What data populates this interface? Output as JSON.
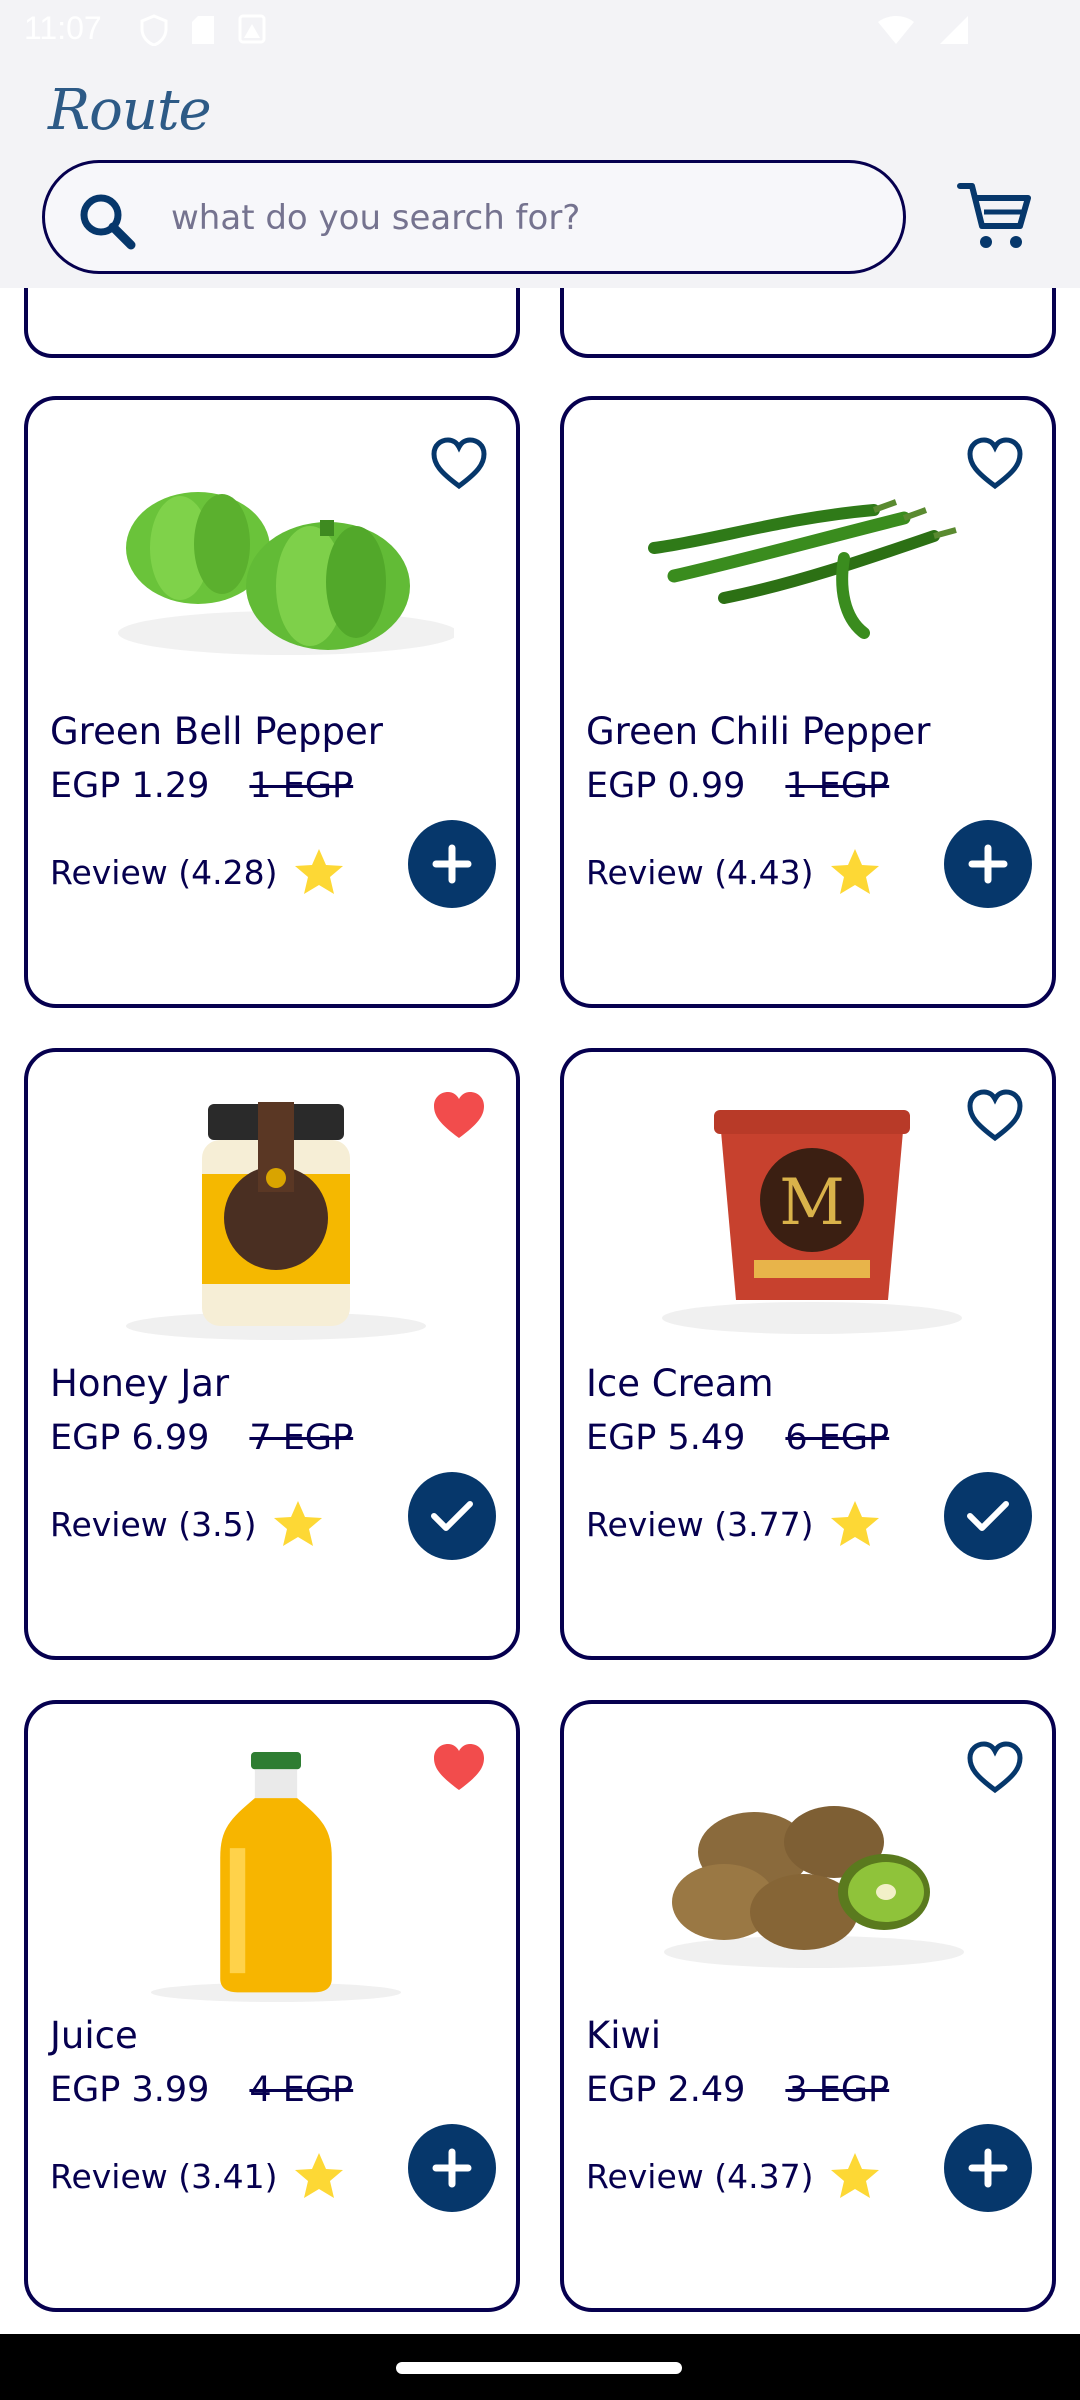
{
  "status_bar": {
    "time": "11:07"
  },
  "header": {
    "logo_text": "Route",
    "search": {
      "placeholder": "what do you search for?",
      "value": ""
    }
  },
  "theme": {
    "primary": "#06004F",
    "button": "#06376b",
    "favorite_active": "#f24c4c",
    "star": "#FDD835"
  },
  "products": [
    {
      "name": "Green Bell Pepper",
      "price": "EGP 1.29",
      "old_price": "1 EGP",
      "review": "Review (4.28)",
      "favorite": false,
      "in_cart": false,
      "image": "green-bell-pepper"
    },
    {
      "name": "Green Chili Pepper",
      "price": "EGP 0.99",
      "old_price": "1 EGP",
      "review": "Review (4.43)",
      "favorite": false,
      "in_cart": false,
      "image": "green-chili-pepper"
    },
    {
      "name": "Honey Jar",
      "price": "EGP 6.99",
      "old_price": "7 EGP",
      "review": "Review (3.5)",
      "favorite": true,
      "in_cart": true,
      "image": "honey-jar"
    },
    {
      "name": "Ice Cream",
      "price": "EGP 5.49",
      "old_price": "6 EGP",
      "review": "Review (3.77)",
      "favorite": false,
      "in_cart": true,
      "image": "ice-cream"
    },
    {
      "name": "Juice",
      "price": "EGP 3.99",
      "old_price": "4 EGP",
      "review": "Review (3.41)",
      "favorite": true,
      "in_cart": false,
      "image": "juice"
    },
    {
      "name": "Kiwi",
      "price": "EGP 2.49",
      "old_price": "3 EGP",
      "review": "Review (4.37)",
      "favorite": false,
      "in_cart": false,
      "image": "kiwi"
    }
  ]
}
